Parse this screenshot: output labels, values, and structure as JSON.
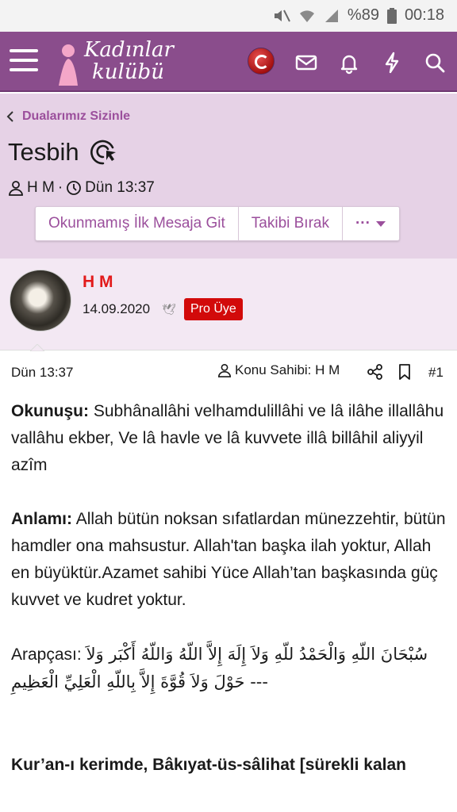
{
  "status_bar": {
    "battery": "%89",
    "time": "00:18"
  },
  "app_bar": {
    "logo_line1": "Kadınlar",
    "logo_line2": "kulübü",
    "icons": [
      "menu-icon",
      "flag-icon",
      "mail-icon",
      "bell-icon",
      "bolt-icon",
      "search-icon"
    ]
  },
  "topic": {
    "breadcrumb": "Dualarımız Sizinle",
    "title": "Tesbih",
    "author": "H M",
    "separator": "·",
    "time": "Dün 13:37",
    "actions": [
      "Okunmamış İlk Mesaja Git",
      "Takibi Bırak",
      "···"
    ]
  },
  "post": {
    "author_name": "H M",
    "join_date": "14.09.2020",
    "badge": "Pro Üye",
    "time": "Dün 13:37",
    "owner_label": "Konu Sahibi: H M",
    "number": "#1",
    "p1_label": "Okunuşu:",
    "p1_text": " Subhânallâhi velhamdulillâhi ve lâ ilâhe illallâhu vallâhu ekber, Ve lâ havle ve lâ kuvvete illâ billâhil aliyyil azîm",
    "p2_label": "Anlamı:",
    "p2_text": " Allah bütün noksan sıfatlardan münezzehtir, bütün hamdler ona mahsustur. Allah'tan başka ilah yoktur, Allah en büyüktür.Azamet sahibi Yüce Allah’tan başkasında güç kuvvet ve kudret yoktur.",
    "p3_label": "Arapçası:",
    "p3_text": "سُبْحَانَ اللّهِ وَالْحَمْدُ للّهِ وَلاَ إِلَهَ إِلاَّ اللّهُ وَاللّهُ أَكْبَر وَلاَ حَوْلَ وَلاَ قُوَّةَ إِلاَّ بِاللّهِ الْعَلِيِّ الْعَظِيمِ ---",
    "p4_text": "Kur’an-ı kerimde, Bâkıyat-üs-sâlihat [sürekli kalan"
  },
  "colors": {
    "header": "#8a4d8c",
    "topic_bg": "#e6d2e6",
    "link": "#9b4f9c",
    "name": "#e21a1a",
    "badge": "#d20a0a"
  }
}
